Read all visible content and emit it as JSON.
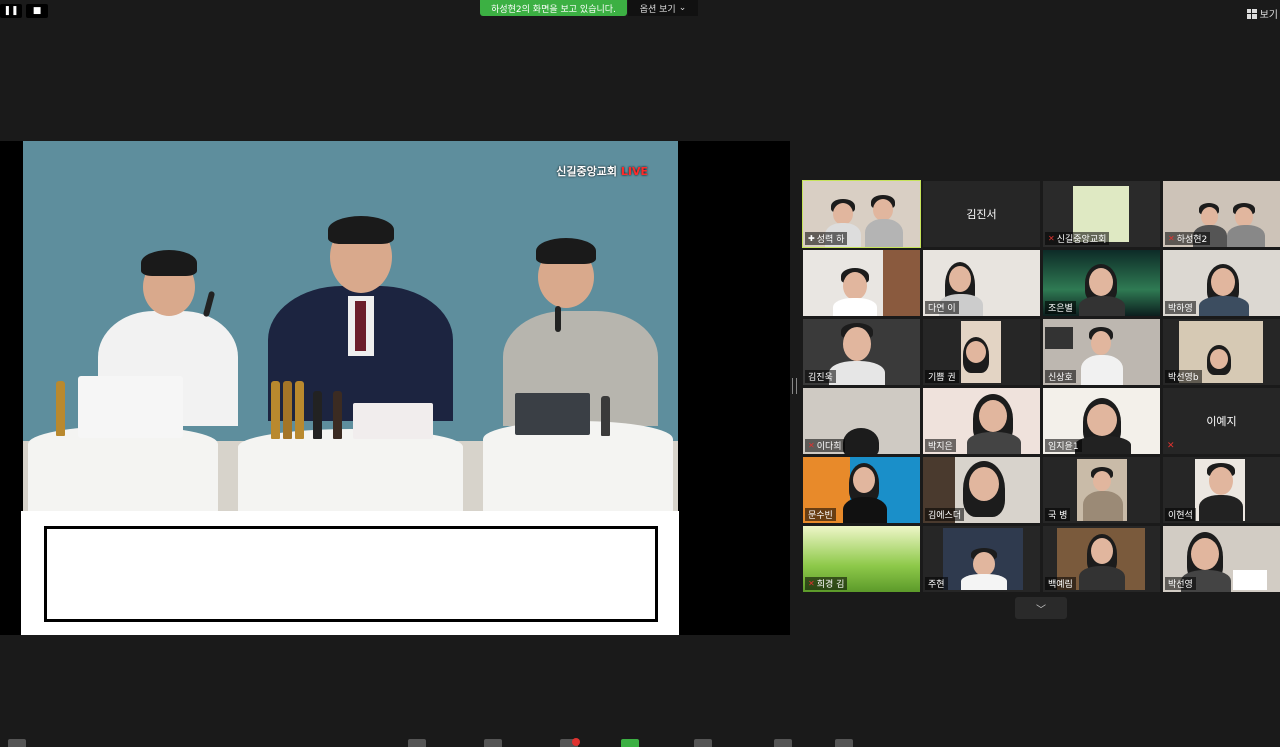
{
  "topbar": {
    "share_banner": "하성현2의 화면을 보고 있습니다.",
    "options_label": "옵션 보기",
    "view_label": "보기"
  },
  "share": {
    "brand": "신길중앙교회",
    "brand_live": "LIVE"
  },
  "participants": [
    {
      "name": "성력 하",
      "muted": false,
      "pinned": true,
      "active": true,
      "type": "video"
    },
    {
      "name": "김진서",
      "muted": false,
      "type": "name-only"
    },
    {
      "name": "신길중앙교회",
      "muted": true,
      "type": "video"
    },
    {
      "name": "하성현2",
      "muted": true,
      "type": "video"
    },
    {
      "name": "",
      "muted": false,
      "type": "video"
    },
    {
      "name": "다연 이",
      "muted": false,
      "type": "video"
    },
    {
      "name": "조은별",
      "muted": false,
      "type": "video"
    },
    {
      "name": "박하영",
      "muted": false,
      "type": "video"
    },
    {
      "name": "김진욱",
      "muted": false,
      "type": "video"
    },
    {
      "name": "기쁨 권",
      "muted": false,
      "type": "video"
    },
    {
      "name": "신상호",
      "muted": false,
      "type": "video"
    },
    {
      "name": "박선영b",
      "muted": false,
      "type": "video"
    },
    {
      "name": "이다희",
      "muted": true,
      "type": "video"
    },
    {
      "name": "박지은",
      "muted": false,
      "type": "video"
    },
    {
      "name": "임지윤1",
      "muted": false,
      "type": "video"
    },
    {
      "name": "이예지",
      "muted": true,
      "type": "name-only"
    },
    {
      "name": "문수빈",
      "muted": false,
      "type": "video"
    },
    {
      "name": "김에스더",
      "muted": false,
      "type": "video"
    },
    {
      "name": "국 병",
      "muted": false,
      "type": "video"
    },
    {
      "name": "이현석",
      "muted": false,
      "type": "video"
    },
    {
      "name": "희경 김",
      "muted": true,
      "type": "video"
    },
    {
      "name": "주현",
      "muted": false,
      "type": "video"
    },
    {
      "name": "백예림",
      "muted": false,
      "type": "video"
    },
    {
      "name": "박선영",
      "muted": false,
      "type": "video"
    }
  ],
  "colors": {
    "banner_green": "#3cb043",
    "active_border": "#c6e35a",
    "mute_red": "#e0322f"
  }
}
